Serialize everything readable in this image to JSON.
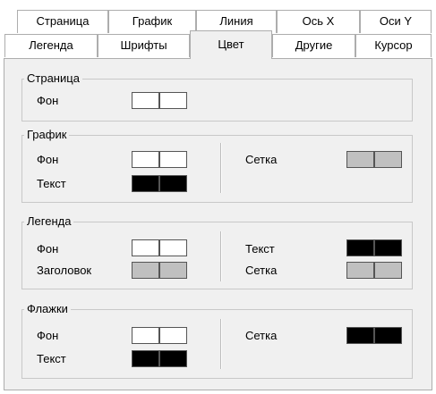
{
  "tabs_row1": [
    "Страница",
    "График",
    "Линия",
    "Ось X",
    "Оси Y"
  ],
  "tabs_row2": [
    "Легенда",
    "Шрифты",
    "Цвет",
    "Другие",
    "Курсор"
  ],
  "active_tab": "Цвет",
  "groups": {
    "page": {
      "title": "Страница",
      "background": {
        "label": "Фон",
        "color": "#ffffff"
      }
    },
    "chart": {
      "title": "График",
      "background": {
        "label": "Фон",
        "color": "#ffffff"
      },
      "text": {
        "label": "Текст",
        "color": "#000000"
      },
      "grid": {
        "label": "Сетка",
        "color": "#c0c0c0"
      }
    },
    "legend": {
      "title": "Легенда",
      "background": {
        "label": "Фон",
        "color": "#ffffff"
      },
      "header": {
        "label": "Заголовок",
        "color": "#c0c0c0"
      },
      "text": {
        "label": "Текст",
        "color": "#000000"
      },
      "grid": {
        "label": "Сетка",
        "color": "#c0c0c0"
      }
    },
    "flags": {
      "title": "Флажки",
      "background": {
        "label": "Фон",
        "color": "#ffffff"
      },
      "text": {
        "label": "Текст",
        "color": "#000000"
      },
      "grid": {
        "label": "Сетка",
        "color": "#000000"
      }
    }
  }
}
